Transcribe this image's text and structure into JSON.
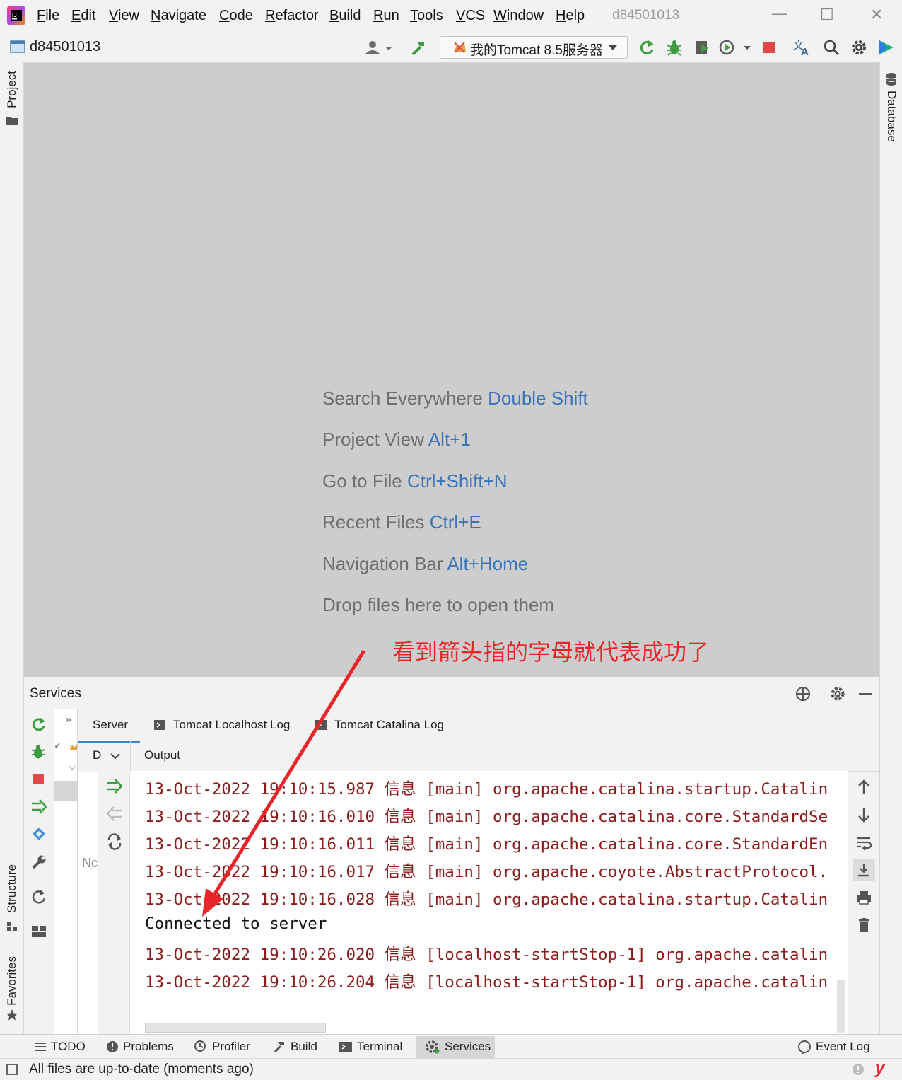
{
  "app": {
    "project_name": "d84501013",
    "window_title": "d84501013"
  },
  "menu": [
    "File",
    "Edit",
    "View",
    "Navigate",
    "Code",
    "Refactor",
    "Build",
    "Run",
    "Tools",
    "VCS",
    "Window",
    "Help"
  ],
  "toolbar": {
    "run_config": "我的Tomcat 8.5服务器"
  },
  "side_tabs": {
    "project": "Project",
    "structure": "Structure",
    "favorites": "Favorites",
    "database": "Database"
  },
  "editor_hints": [
    {
      "text": "Search Everywhere",
      "key": "Double Shift"
    },
    {
      "text": "Project View",
      "key": "Alt+1"
    },
    {
      "text": "Go to File",
      "key": "Ctrl+Shift+N"
    },
    {
      "text": "Recent Files",
      "key": "Ctrl+E"
    },
    {
      "text": "Navigation Bar",
      "key": "Alt+Home"
    },
    {
      "text": "Drop files here to open them",
      "key": ""
    }
  ],
  "annotation": "看到箭头指的字母就代表成功了",
  "services": {
    "title": "Services",
    "tabs": [
      "Server",
      "Tomcat Localhost Log",
      "Tomcat Catalina Log"
    ],
    "subheader": "D",
    "output_label": "Output",
    "tree_placeholder": "Nc",
    "log_lines": [
      "13-Oct-2022 19:10:15.987 信息 [main] org.apache.catalina.startup.Catalin",
      "13-Oct-2022 19:10:16.010 信息 [main] org.apache.catalina.core.StandardSe",
      "13-Oct-2022 19:10:16.011 信息 [main] org.apache.catalina.core.StandardEn",
      "13-Oct-2022 19:10:16.017 信息 [main] org.apache.coyote.AbstractProtocol.",
      "13-Oct-2022 19:10:16.028 信息 [main] org.apache.catalina.startup.Catalin",
      "Connected to server",
      "13-Oct-2022 19:10:26.020 信息 [localhost-startStop-1] org.apache.catalin",
      "13-Oct-2022 19:10:26.204 信息 [localhost-startStop-1] org.apache.catalin"
    ]
  },
  "bottom_tabs": [
    "TODO",
    "Problems",
    "Profiler",
    "Build",
    "Terminal",
    "Services"
  ],
  "event_log": "Event Log",
  "status": "All files are up-to-date (moments ago)",
  "colors": {
    "accent_link": "#3b74b8",
    "log_red": "#8c1b1b",
    "annotation_red": "#e8262a",
    "run_green": "#3f9b3f",
    "stop_red": "#e04848"
  }
}
